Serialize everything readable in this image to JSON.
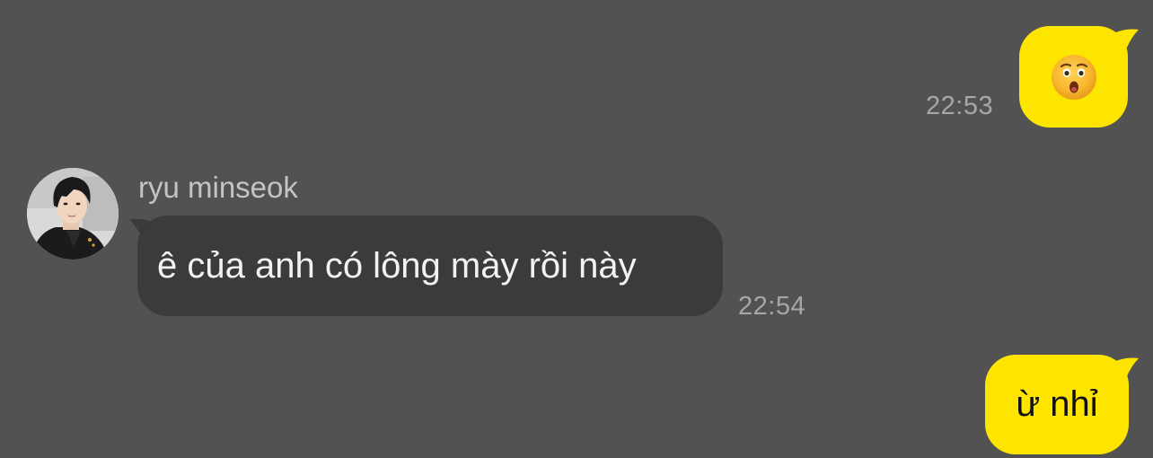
{
  "chat": {
    "messages": [
      {
        "direction": "outgoing",
        "content_type": "emoji",
        "emoji": "😲",
        "icon": "astonished-face-icon",
        "time": "22:53"
      },
      {
        "direction": "incoming",
        "sender": "ryu minseok",
        "avatar_icon": "avatar-photo",
        "text": "ê của anh có lông mày rồi này",
        "time": "22:54"
      },
      {
        "direction": "outgoing",
        "content_type": "text",
        "text": "ừ nhỉ"
      }
    ]
  },
  "colors": {
    "background": "#535253",
    "outgoing_bubble": "#fee500",
    "incoming_bubble": "#3b3a3c",
    "timestamp": "#a6a6a8",
    "sender_name": "#c4c4c6"
  }
}
